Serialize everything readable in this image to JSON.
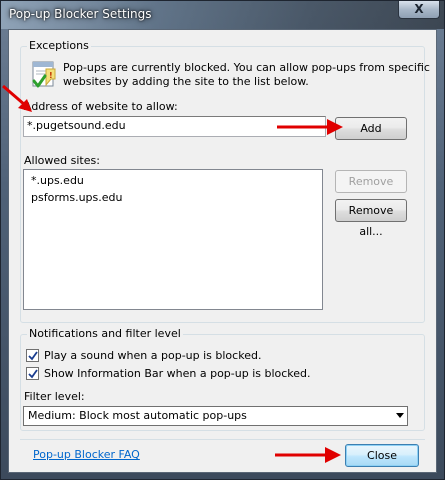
{
  "window": {
    "title": "Pop-up Blocker Settings",
    "close_glyph": "X"
  },
  "exceptions": {
    "legend": "Exceptions",
    "info_line1": "Pop-ups are currently blocked.  You can allow pop-ups from specific",
    "info_line2": "websites by adding the site to the list below.",
    "address_label": "Address of website to allow:",
    "address_value": "*.pugetsound.edu",
    "add_button": "Add",
    "allowed_label": "Allowed sites:",
    "allowed_sites": [
      "*.ups.edu",
      "psforms.ups.edu"
    ],
    "remove_button": "Remove",
    "remove_all_button": "Remove all..."
  },
  "notifications": {
    "legend": "Notifications and filter level",
    "play_sound_label": "Play a sound when a pop-up is blocked.",
    "play_sound_checked": true,
    "show_info_bar_label": "Show Information Bar when a pop-up is blocked.",
    "show_info_bar_checked": true,
    "filter_level_label": "Filter level:",
    "filter_level_value": "Medium: Block most automatic pop-ups"
  },
  "footer": {
    "faq_link": "Pop-up Blocker FAQ",
    "close_button": "Close"
  },
  "colors": {
    "annotation_arrow": "#e00000",
    "link": "#0066cc"
  }
}
